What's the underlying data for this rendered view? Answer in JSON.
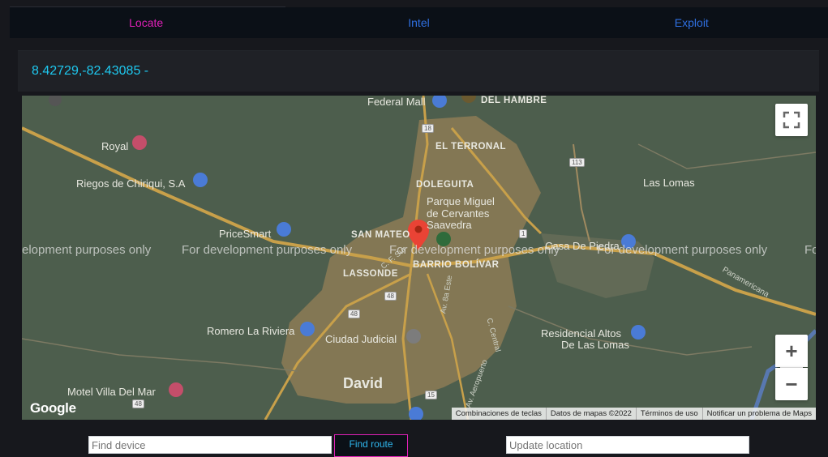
{
  "tabs": [
    {
      "label": "Locate",
      "active": true
    },
    {
      "label": "Intel",
      "active": false
    },
    {
      "label": "Exploit",
      "active": false
    }
  ],
  "coordinates": "8.42729,-82.43085 -",
  "map": {
    "place_labels": {
      "federal_mall": "Federal Mall",
      "del_hambre": "DEL HAMBRE",
      "royal": "Royal",
      "el_terronal": "EL TERRONAL",
      "riegos": "Riegos de Chiriqui, S.A",
      "doleguita": "DOLEGUITA",
      "parque": "Parque Miguel",
      "parque2": "de Cervantes",
      "parque3": "Saavedra",
      "las_lomas": "Las Lomas",
      "pricesmart": "PriceSmart",
      "san_mateo": "SAN MATEO",
      "barrio_bolivar": "BARRIO BOLÍVAR",
      "lassonde": "LASSONDE",
      "casa_de_piedra": "Casa De Piedra",
      "panamericana": "Panamericana",
      "av_8a_este": "Av. 8a Este",
      "c_central": "C. Central",
      "romero": "Romero La Riviera",
      "ciudad_judicial": "Ciudad Judicial",
      "residencial": "Residencial Altos",
      "residencial2": "De Las Lomas",
      "david": "David",
      "motel": "Motel Villa Del Mar",
      "av_aeropuerto": "Av. Aeropuerto",
      "c_sur": "C. F. Sur"
    },
    "road_shields": [
      "18",
      "113",
      "1",
      "48",
      "48",
      "15",
      "48"
    ],
    "dev_watermark": "For development purposes only",
    "dev_watermark_clipped": "elopment purposes only",
    "dev_watermark_clipped_end": "Fo",
    "google_logo": "Google",
    "attribution": [
      "Combinaciones de teclas",
      "Datos de mapas ©2022",
      "Términos de uso",
      "Notificar un problema de Maps"
    ],
    "controls": {
      "fullscreen_icon": "fullscreen-icon",
      "zoom_in": "+",
      "zoom_out": "−"
    },
    "marker_color": "#ea4335"
  },
  "inputs": {
    "find_device_placeholder": "Find device",
    "find_route_label": "Find route",
    "update_location_placeholder": "Update location"
  },
  "colors": {
    "active_tab": "#e020b8",
    "inactive_tab": "#2f6fe0",
    "coords": "#1ec8ef"
  }
}
